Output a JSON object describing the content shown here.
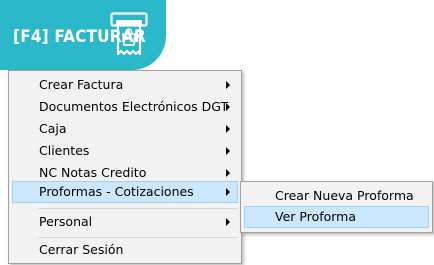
{
  "button": {
    "label": "[F4] FACTURAR",
    "icon": "cash-register-icon"
  },
  "colors": {
    "button_bg": "#2bb8cb",
    "menu_bg": "#f2f2f2",
    "highlight_bg": "#cce8ff",
    "highlight_border": "#99d1ff"
  },
  "main_menu": {
    "items": [
      {
        "label": "Crear Factura",
        "has_submenu": true
      },
      {
        "label": "Documentos Electrónicos DGT",
        "has_submenu": true
      },
      {
        "label": "Caja",
        "has_submenu": true
      },
      {
        "label": "Clientes",
        "has_submenu": true
      },
      {
        "label": "NC Notas Credito",
        "has_submenu": true
      },
      {
        "label": "Proformas - Cotizaciones",
        "has_submenu": true,
        "highlighted": true
      },
      {
        "label": "Personal",
        "has_submenu": true
      },
      {
        "label": "Cerrar Sesión",
        "has_submenu": false
      }
    ]
  },
  "sub_menu": {
    "items": [
      {
        "label": "Crear Nueva Proforma"
      },
      {
        "label": "Ver Proforma",
        "highlighted": true
      }
    ]
  }
}
